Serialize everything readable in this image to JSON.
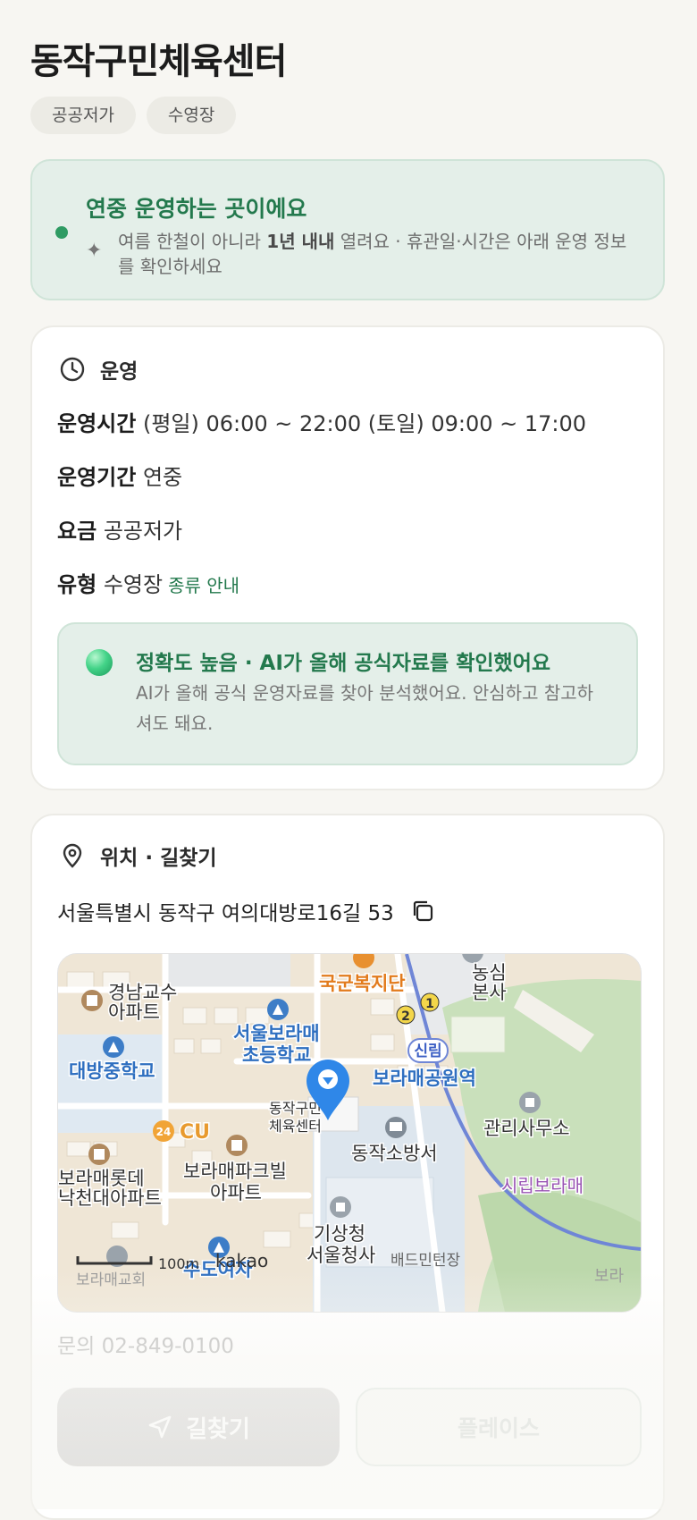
{
  "header": {
    "title": "동작구민체육센터",
    "chips": [
      "공공저가",
      "수영장"
    ]
  },
  "notice": {
    "title": "연중 운영하는 곳이에요",
    "desc_pre": "여름 한철이 아니라 ",
    "desc_bold": "1년 내내",
    "desc_post": " 열려요 · 휴관일·시간은 아래 운영 정보를 확인하세요"
  },
  "operation": {
    "heading": "운영",
    "hours_label": "운영시간",
    "hours_value": "(평일) 06:00 ~ 22:00 (토일) 09:00 ~ 17:00",
    "period_label": "운영기간",
    "period_value": "연중",
    "fee_label": "요금",
    "fee_value": "공공저가",
    "type_label": "유형",
    "type_value": "수영장",
    "type_link": "종류 안내",
    "accuracy_title": "정확도 높음 · AI가 올해 공식자료를 확인했어요",
    "accuracy_desc": "AI가 올해 공식 운영자료를 찾아 분석했어요. 안심하고 참고하셔도 돼요."
  },
  "location": {
    "heading": "위치 · 길찾기",
    "address": "서울특별시 동작구 여의대방로16길 53",
    "phone": "문의 02-849-0100",
    "directions_label": "길찾기",
    "place_label": "플레이스"
  },
  "map": {
    "labels": {
      "apt1": "경남교수",
      "apt1b": "아파트",
      "school1": "서울보라매",
      "school1b": "초등학교",
      "middle": "대방중학교",
      "military": "국군복지단",
      "nongshim1": "농심",
      "nongshim2": "본사",
      "station_tag": "신림",
      "station": "보라매공원역",
      "target1": "동작구민",
      "target2": "체육센터",
      "cu": "CU",
      "fire": "동작소방서",
      "office": "관리사무소",
      "park": "시립보라매",
      "lotte1": "보라매롯데",
      "lotte2": "낙천대아파트",
      "park_apt1": "보라매파크빌",
      "park_apt2": "아파트",
      "kma1": "기상청",
      "kma2": "서울청사",
      "badminton": "배드민턴장",
      "scale": "100m",
      "logo": "kakao",
      "girls": "수도여자",
      "church": "보라매교회",
      "bora": "보라"
    },
    "line1": "1",
    "line2": "2",
    "cu_badge": "24"
  },
  "colors": {
    "accent": "#23794d",
    "notice_bg": "#e4efe9",
    "map_park": "#c9e0bb",
    "map_residential": "#efe6d6",
    "subway": "#6f86d6"
  }
}
